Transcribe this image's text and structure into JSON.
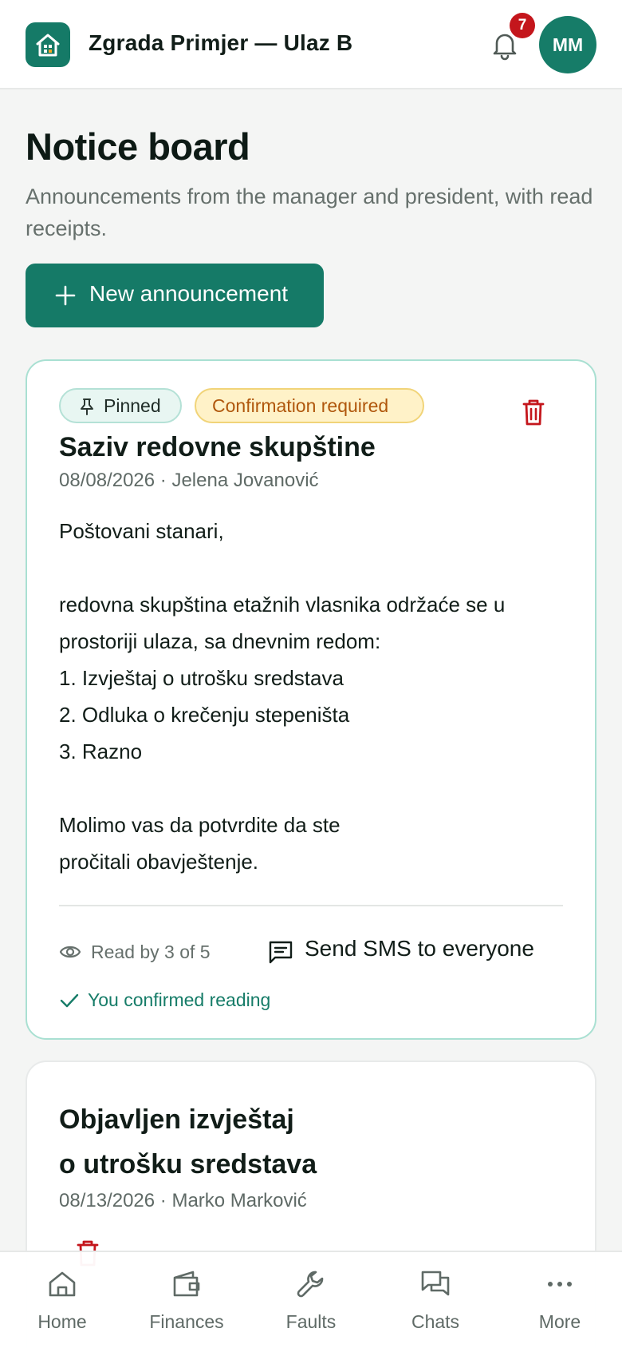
{
  "header": {
    "app_title": "Zgrada Primjer — Ulaz B",
    "notification_count": "7",
    "avatar_initials": "MM"
  },
  "page": {
    "title": "Notice board",
    "subtitle": "Announcements from the manager and president, with read receipts.",
    "new_button_label": "New announcement"
  },
  "announcements": [
    {
      "tags": [
        "Pinned",
        "Confirmation required"
      ],
      "title": "Saziv redovne skupštine",
      "meta": "08/08/2026 · Jelena Jovanović",
      "body": "Poštovani stanari,\n\nredovna skupština etažnih vlasnika održaće se u prostoriji ulaza, sa dnevnim redom:\n1. Izvještaj o utrošku sredstava\n2. Odluka o krečenju stepeništa\n3. Razno\n\nMolimo vas da potvrdite da ste\npročitali obavještenje.",
      "read_status": "Read by 3 of 5",
      "sms_label": "Send SMS to everyone",
      "confirmed_label": "You confirmed reading"
    },
    {
      "title_line1": "Objavljen izvještaj",
      "title_line2": "o utrošku sredstava",
      "meta": "08/13/2026 · Marko Marković"
    }
  ],
  "bottom_nav": [
    {
      "label": "Home",
      "icon": "home-icon"
    },
    {
      "label": "Finances",
      "icon": "wallet-icon"
    },
    {
      "label": "Faults",
      "icon": "wrench-icon"
    },
    {
      "label": "Chats",
      "icon": "chat-icon"
    },
    {
      "label": "More",
      "icon": "more-icon"
    }
  ],
  "colors": {
    "accent": "#157a67",
    "danger": "#c4161c",
    "warning_bg": "#fff2c8",
    "warning_text": "#b0570c"
  }
}
